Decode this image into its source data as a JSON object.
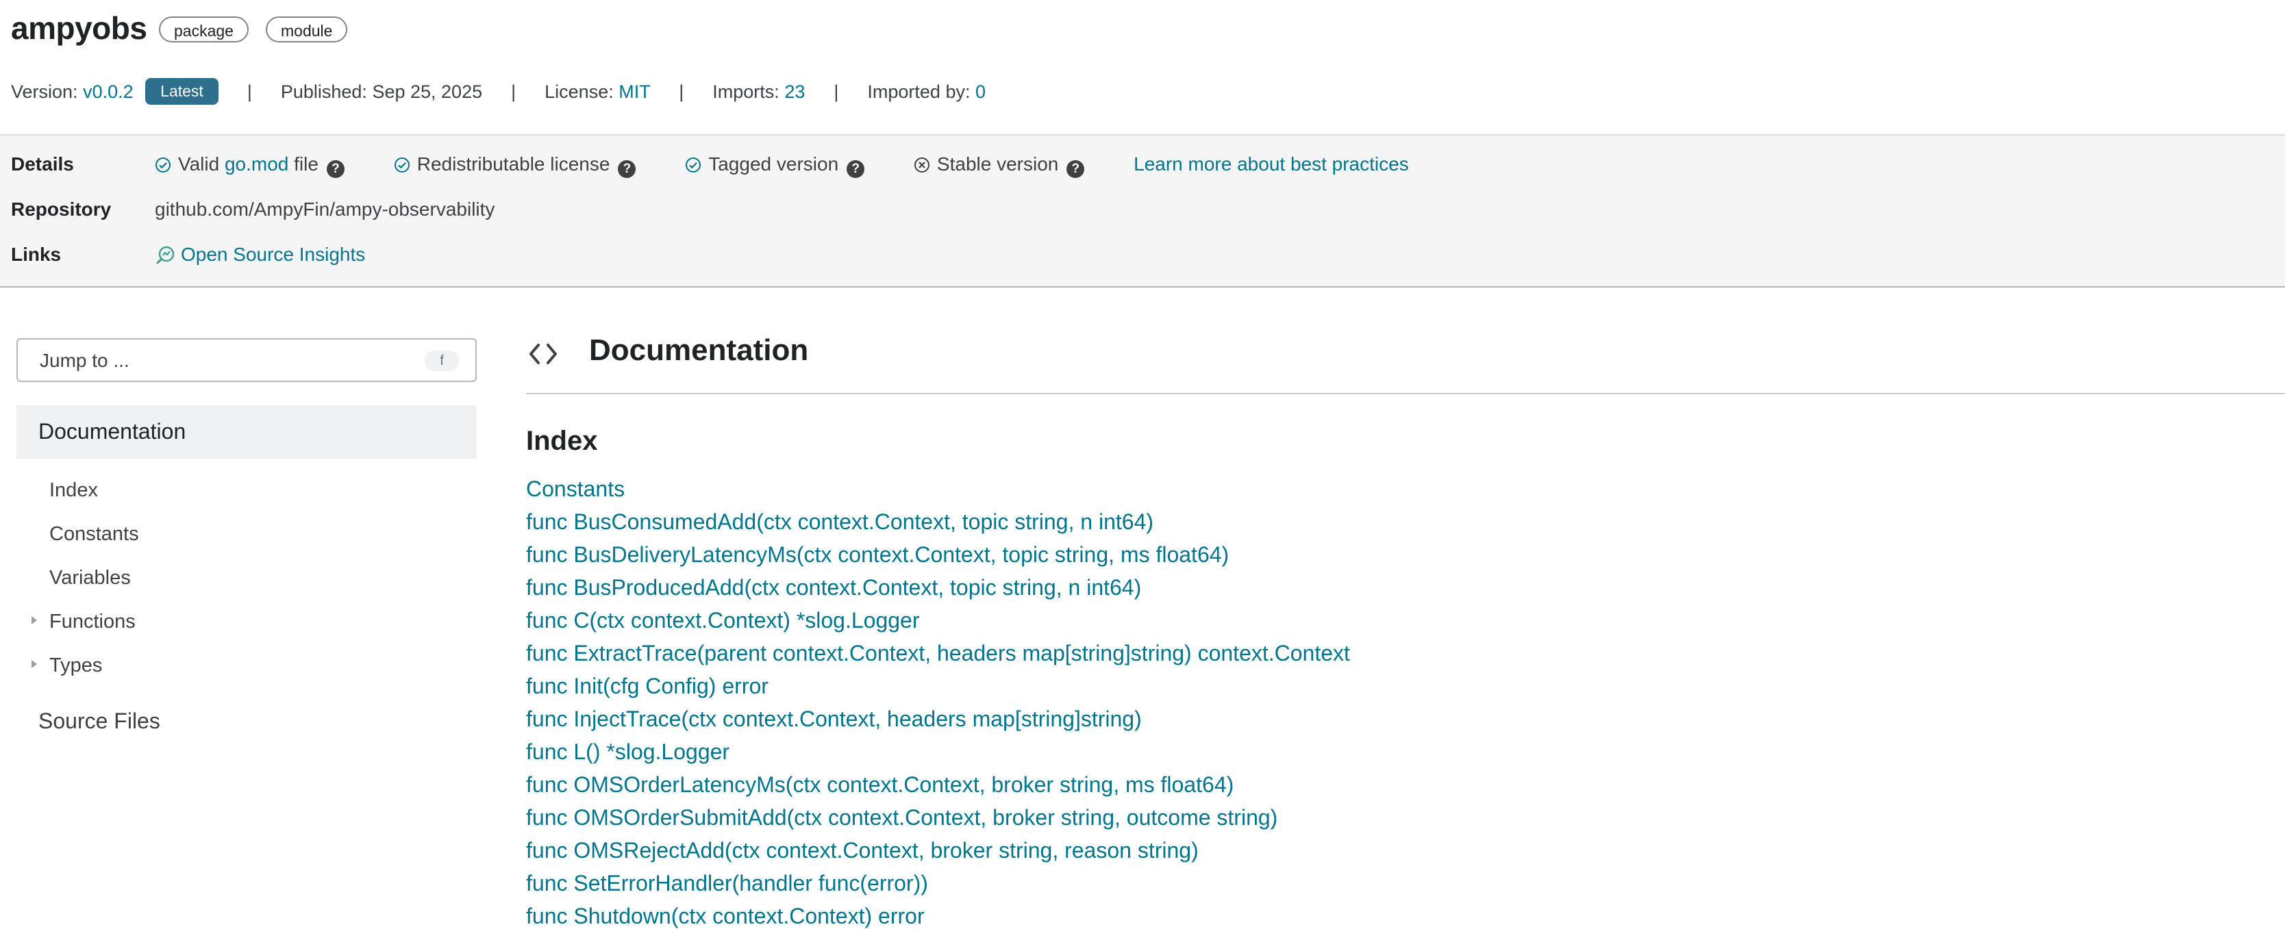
{
  "package": {
    "name": "ampyobs",
    "chips": [
      "package",
      "module"
    ]
  },
  "meta": {
    "version_label": "Version:",
    "version": "v0.0.2",
    "latest_badge": "Latest",
    "separator": "|",
    "published_label": "Published:",
    "published": "Sep 25, 2025",
    "license_label": "License:",
    "license": "MIT",
    "imports_label": "Imports:",
    "imports": "23",
    "imported_by_label": "Imported by:",
    "imported_by": "0"
  },
  "details": {
    "label": "Details",
    "valid_prefix": "Valid",
    "valid_link": "go.mod",
    "valid_suffix": "file",
    "redistributable": "Redistributable license",
    "tagged": "Tagged version",
    "stable": "Stable version",
    "learn_more": "Learn more about best practices",
    "help_glyph": "?"
  },
  "repository": {
    "label": "Repository",
    "url": "github.com/AmpyFin/ampy-observability"
  },
  "links": {
    "label": "Links",
    "open_source_insights": "Open Source Insights"
  },
  "sidebar": {
    "jump_placeholder": "Jump to ...",
    "jump_shortcut": "f",
    "documentation": "Documentation",
    "items": [
      {
        "label": "Index",
        "expandable": false
      },
      {
        "label": "Constants",
        "expandable": false
      },
      {
        "label": "Variables",
        "expandable": false
      },
      {
        "label": "Functions",
        "expandable": true
      },
      {
        "label": "Types",
        "expandable": true
      }
    ],
    "source_files": "Source Files"
  },
  "main": {
    "heading": "Documentation",
    "index_heading": "Index",
    "index_items": [
      "Constants",
      "func BusConsumedAdd(ctx context.Context, topic string, n int64)",
      "func BusDeliveryLatencyMs(ctx context.Context, topic string, ms float64)",
      "func BusProducedAdd(ctx context.Context, topic string, n int64)",
      "func C(ctx context.Context) *slog.Logger",
      "func ExtractTrace(parent context.Context, headers map[string]string) context.Context",
      "func Init(cfg Config) error",
      "func InjectTrace(ctx context.Context, headers map[string]string)",
      "func L() *slog.Logger",
      "func OMSOrderLatencyMs(ctx context.Context, broker string, ms float64)",
      "func OMSOrderSubmitAdd(ctx context.Context, broker string, outcome string)",
      "func OMSRejectAdd(ctx context.Context, broker string, reason string)",
      "func SetErrorHandler(handler func(error))",
      "func Shutdown(ctx context.Context) error"
    ]
  },
  "colors": {
    "link": "#00758f",
    "badge": "#2e6f8e",
    "band": "#f5f5f6"
  }
}
